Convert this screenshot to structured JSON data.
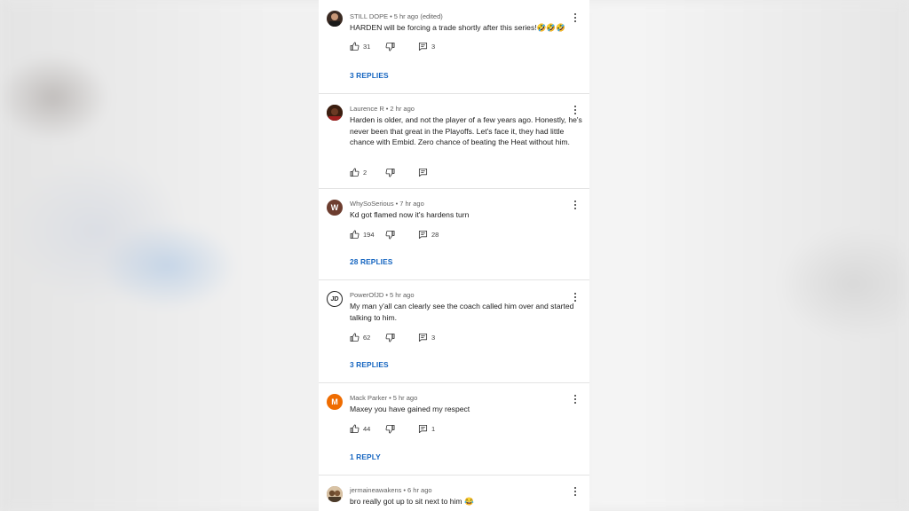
{
  "comments": [
    {
      "author": "STILL DOPE",
      "time": "5 hr ago (edited)",
      "text": "HARDEN will be forcing a trade shortly after this series!🤣🤣🤣",
      "likes": "31",
      "reply_count": "3",
      "replies_link": "3 REPLIES",
      "avatar_color": "#3a2a22"
    },
    {
      "author": "Laurence R",
      "time": "2 hr ago",
      "text": "Harden is older, and not the player of a few years ago. Honestly, he's never been that great in the Playoffs. Let's face it, they had little chance with Embid. Zero chance of beating the Heat without him.",
      "likes": "2",
      "reply_count": "",
      "replies_link": "",
      "avatar_color": "#5a2a1a"
    },
    {
      "author": "WhySoSerious",
      "time": "7 hr ago",
      "text": "Kd got flamed now it's hardens turn",
      "likes": "194",
      "reply_count": "28",
      "replies_link": "28 REPLIES",
      "avatar_letter": "W",
      "avatar_color": "#6d3d2f"
    },
    {
      "author": "PowerOfJD",
      "time": "5 hr ago",
      "text": "My man y'all can clearly see the coach called him over and started talking to him.",
      "likes": "62",
      "reply_count": "3",
      "replies_link": "3 REPLIES",
      "avatar_letter": "JD",
      "avatar_color": "#222222"
    },
    {
      "author": "Mack Parker",
      "time": "5 hr ago",
      "text": "Maxey you have gained my respect",
      "likes": "44",
      "reply_count": "1",
      "replies_link": "1 REPLY",
      "avatar_letter": "M",
      "avatar_color": "#ef6c00"
    },
    {
      "author": "jermaineawakens",
      "time": "6 hr ago",
      "text": "bro really got up to sit next to him 😂",
      "likes": "",
      "reply_count": "",
      "replies_link": "",
      "avatar_color": "#8a6a4a"
    }
  ],
  "colors": {
    "link": "#1565c0",
    "meta": "#606060",
    "text": "#202020"
  },
  "icons": {
    "like": "thumbs-up-icon",
    "dislike": "thumbs-down-icon",
    "reply": "reply-comment-icon",
    "more": "more-vert-icon"
  }
}
